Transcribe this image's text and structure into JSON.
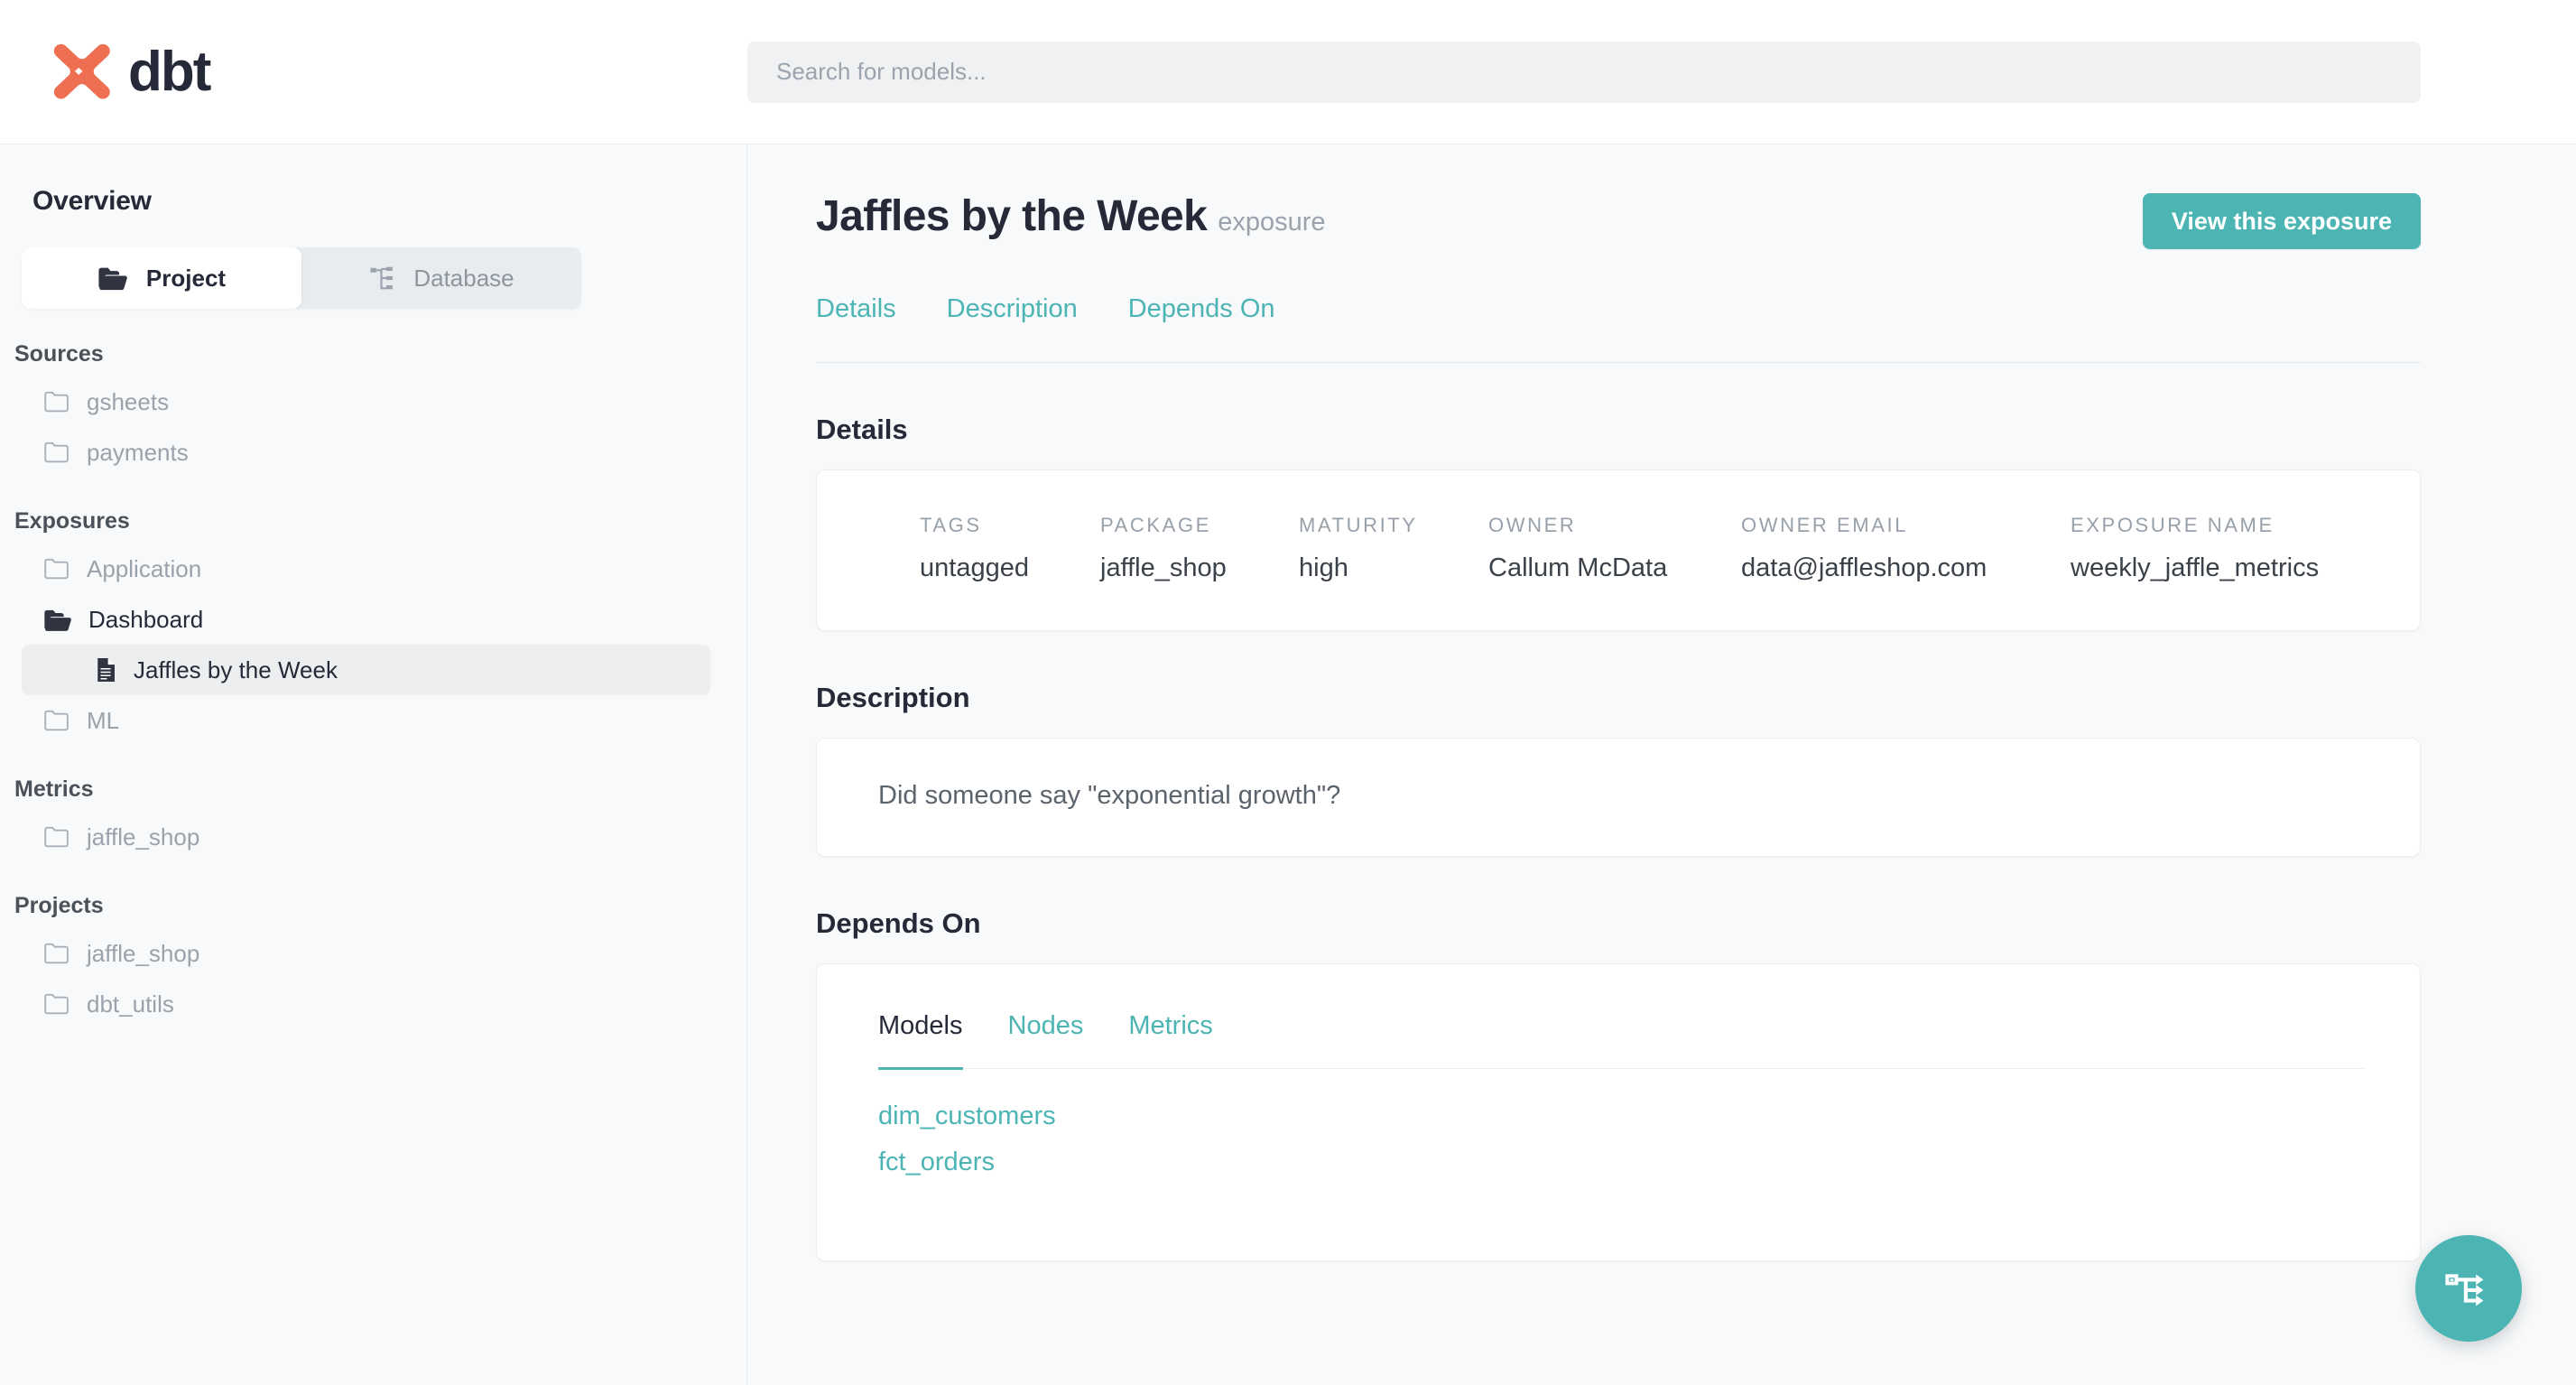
{
  "brand": {
    "name": "dbt",
    "logo_color": "#ef6f52",
    "text_color": "#262a38",
    "accent_color": "#4cb5b4"
  },
  "search": {
    "placeholder": "Search for models...",
    "value": ""
  },
  "sidebar": {
    "title": "Overview",
    "toggle": {
      "project_label": "Project",
      "database_label": "Database",
      "active": "Project"
    },
    "sections": [
      {
        "label": "Sources",
        "items": [
          {
            "label": "gsheets",
            "icon": "folder-closed-icon",
            "state": "closed"
          },
          {
            "label": "payments",
            "icon": "folder-closed-icon",
            "state": "closed"
          }
        ]
      },
      {
        "label": "Exposures",
        "items": [
          {
            "label": "Application",
            "icon": "folder-closed-icon",
            "state": "closed"
          },
          {
            "label": "Dashboard",
            "icon": "folder-open-icon",
            "state": "open"
          },
          {
            "label": "Jaffles by the Week",
            "icon": "document-icon",
            "state": "selected"
          },
          {
            "label": "ML",
            "icon": "folder-closed-icon",
            "state": "closed"
          }
        ]
      },
      {
        "label": "Metrics",
        "items": [
          {
            "label": "jaffle_shop",
            "icon": "folder-closed-icon",
            "state": "closed"
          }
        ]
      },
      {
        "label": "Projects",
        "items": [
          {
            "label": "jaffle_shop",
            "icon": "folder-closed-icon",
            "state": "closed"
          },
          {
            "label": "dbt_utils",
            "icon": "folder-closed-icon",
            "state": "closed"
          }
        ]
      }
    ]
  },
  "page": {
    "title": "Jaffles by the Week",
    "kind": "exposure",
    "view_button_label": "View this exposure",
    "anchors": [
      {
        "label": "Details"
      },
      {
        "label": "Description"
      },
      {
        "label": "Depends On"
      }
    ]
  },
  "details": {
    "heading": "Details",
    "fields": [
      {
        "label": "Tags",
        "value": "untagged"
      },
      {
        "label": "Package",
        "value": "jaffle_shop"
      },
      {
        "label": "Maturity",
        "value": "high"
      },
      {
        "label": "Owner",
        "value": "Callum McData"
      },
      {
        "label": "Owner Email",
        "value": "data@jaffleshop.com"
      },
      {
        "label": "Exposure Name",
        "value": "weekly_jaffle_metrics"
      }
    ]
  },
  "description": {
    "heading": "Description",
    "text": "Did someone say \"exponential growth\"?"
  },
  "depends_on": {
    "heading": "Depends On",
    "tabs": [
      {
        "label": "Models",
        "active": true
      },
      {
        "label": "Nodes",
        "active": false
      },
      {
        "label": "Metrics",
        "active": false
      }
    ],
    "models": [
      {
        "label": "dim_customers"
      },
      {
        "label": "fct_orders"
      }
    ]
  },
  "fab": {
    "icon": "lineage-graph-icon"
  }
}
